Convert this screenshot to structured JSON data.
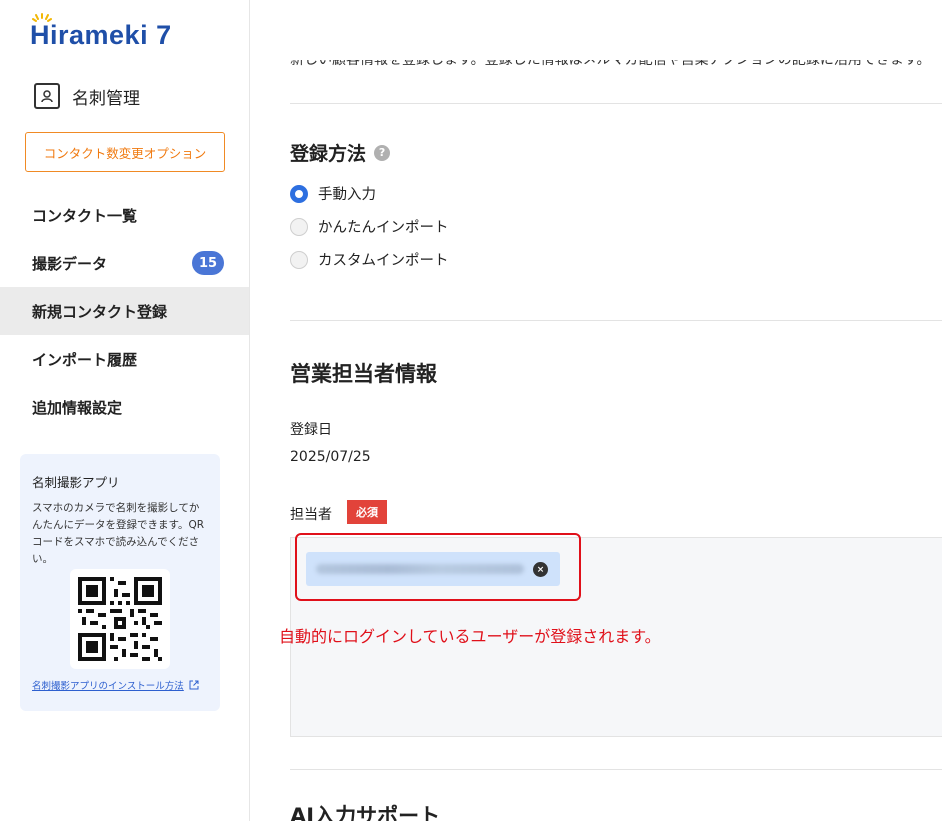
{
  "brand": {
    "logo_text": "Hirameki 7",
    "primary_color": "#1f4fa8"
  },
  "sidebar": {
    "section_title": "名刺管理",
    "option_button": "コンタクト数変更オプション",
    "nav_items": [
      {
        "label": "コンタクト一覧"
      },
      {
        "label": "撮影データ",
        "badge": "15"
      },
      {
        "label": "新規コンタクト登録",
        "active": true
      },
      {
        "label": "インポート履歴"
      },
      {
        "label": "追加情報設定"
      }
    ],
    "app_card": {
      "title": "名刺撮影アプリ",
      "description": "スマホのカメラで名刺を撮影してかんたんにデータを登録できます。QRコードをスマホで読み込んでください。",
      "link_text": "名刺撮影アプリのインストール方法"
    }
  },
  "main": {
    "intro_text": "新しい顧客情報を登録します。登録した情報はメルマガ配信や営業アクションの記録に活用できます。",
    "registration_method": {
      "title": "登録方法",
      "help_icon": "?",
      "options": [
        {
          "label": "手動入力",
          "checked": true
        },
        {
          "label": "かんたんインポート",
          "checked": false
        },
        {
          "label": "カスタムインポート",
          "checked": false
        }
      ]
    },
    "sales_info": {
      "title": "営業担当者情報",
      "date_label": "登録日",
      "date_value": "2025/07/25",
      "assignee_label": "担当者",
      "required_badge": "必須",
      "chip_remove": "×"
    },
    "annotation": "自動的にログインしているユーザーが登録されます。",
    "next_section_title": "AI入力サポート"
  }
}
